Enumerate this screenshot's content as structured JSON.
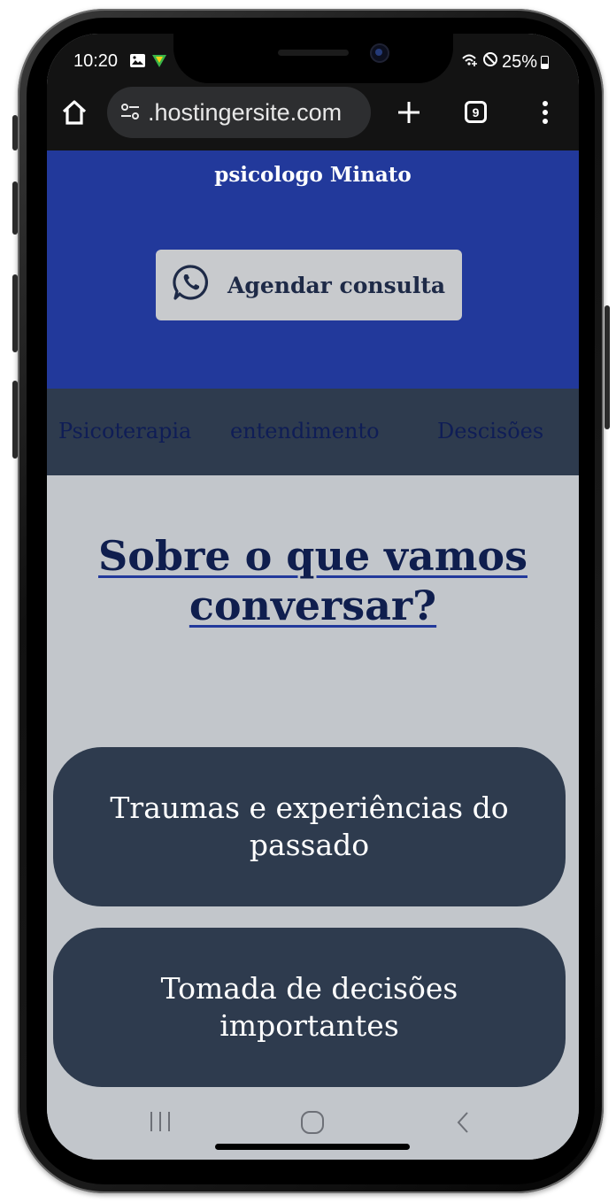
{
  "status_bar": {
    "time": "10:20",
    "battery_percent": "25%",
    "icons": [
      "gallery-icon",
      "vpn-icon",
      "wifi-calling-icon",
      "do-not-disturb-icon",
      "battery-icon"
    ]
  },
  "browser": {
    "url": ".hostingersite.com",
    "tab_count": "9",
    "icons": [
      "home-icon",
      "site-settings-icon",
      "new-tab-icon",
      "tab-switcher-icon",
      "menu-icon"
    ]
  },
  "header": {
    "title": "psicologo Minato",
    "cta_label": "Agendar consulta",
    "cta_icon": "whatsapp-icon"
  },
  "nav": {
    "items": [
      "Psicoterapia",
      "entendimento",
      "Descisões"
    ]
  },
  "main": {
    "heading_line1": "Sobre o que vamos",
    "heading_line2": "conversar?",
    "topics": [
      "Traumas e experiências do passado",
      "Tomada de decisões importantes"
    ]
  },
  "colors": {
    "header_bg": "#22399b",
    "nav_bg": "#2e3b4e",
    "page_bg": "#c2c6cb",
    "card_bg": "#2e3b4e",
    "heading_color": "#0f1e4e"
  }
}
